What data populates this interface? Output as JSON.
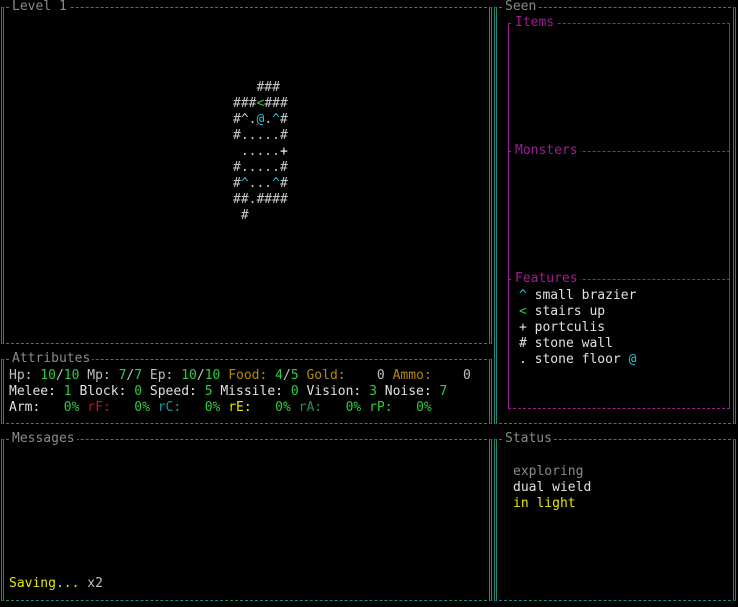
{
  "panels": {
    "map_title": "Level 1",
    "seen_title": "Seen",
    "items_title": "Items",
    "monsters_title": "Monsters",
    "features_title": "Features",
    "attributes_title": "Attributes",
    "messages_title": "Messages",
    "status_title": "Status"
  },
  "map": {
    "rows": [
      "   ###",
      "###<###",
      "#^.@.^#",
      "#.....#",
      " .....+",
      "#.....#",
      "#^...^#",
      "##.####",
      " #"
    ]
  },
  "features": [
    {
      "glyph": "^",
      "label": "small brazier",
      "color": "#e0e0e0"
    },
    {
      "glyph": "<",
      "label": "stairs up",
      "color": "#2ecc40"
    },
    {
      "glyph": "+",
      "label": "portculis",
      "color": "#e0e0e0"
    },
    {
      "glyph": "#",
      "label": "stone wall",
      "color": "#e0e0e0"
    },
    {
      "glyph": ".",
      "label": "stone floor",
      "color": "#e0e0e0",
      "extra": "@"
    }
  ],
  "attributes": {
    "hp_label": "Hp:",
    "hp_cur": "10",
    "hp_max": "10",
    "mp_label": "Mp:",
    "mp_cur": "7",
    "mp_max": "7",
    "ep_label": "Ep:",
    "ep_cur": "10",
    "ep_max": "10",
    "food_label": "Food:",
    "food_cur": "4",
    "food_max": "5",
    "gold_label": "Gold:",
    "gold_val": "0",
    "ammo_label": "Ammo:",
    "ammo_val": "0",
    "melee_label": "Melee:",
    "melee_val": "1",
    "block_label": "Block:",
    "block_val": "0",
    "speed_label": "Speed:",
    "speed_val": "5",
    "missile_label": "Missile:",
    "missile_val": "0",
    "vision_label": "Vision:",
    "vision_val": "3",
    "noise_label": "Noise:",
    "noise_val": "7",
    "arm_label": "Arm:",
    "arm_val": "0%",
    "rf_label": "rF:",
    "rf_val": "0%",
    "rc_label": "rC:",
    "rc_val": "0%",
    "re_label": "rE:",
    "re_val": "0%",
    "ra_label": "rA:",
    "ra_val": "0%",
    "rp_label": "rP:",
    "rp_val": "0%"
  },
  "messages": {
    "last": "Saving...",
    "count": "x2"
  },
  "status": {
    "line1": "exploring",
    "line2": "dual wield",
    "line3": "in light"
  }
}
